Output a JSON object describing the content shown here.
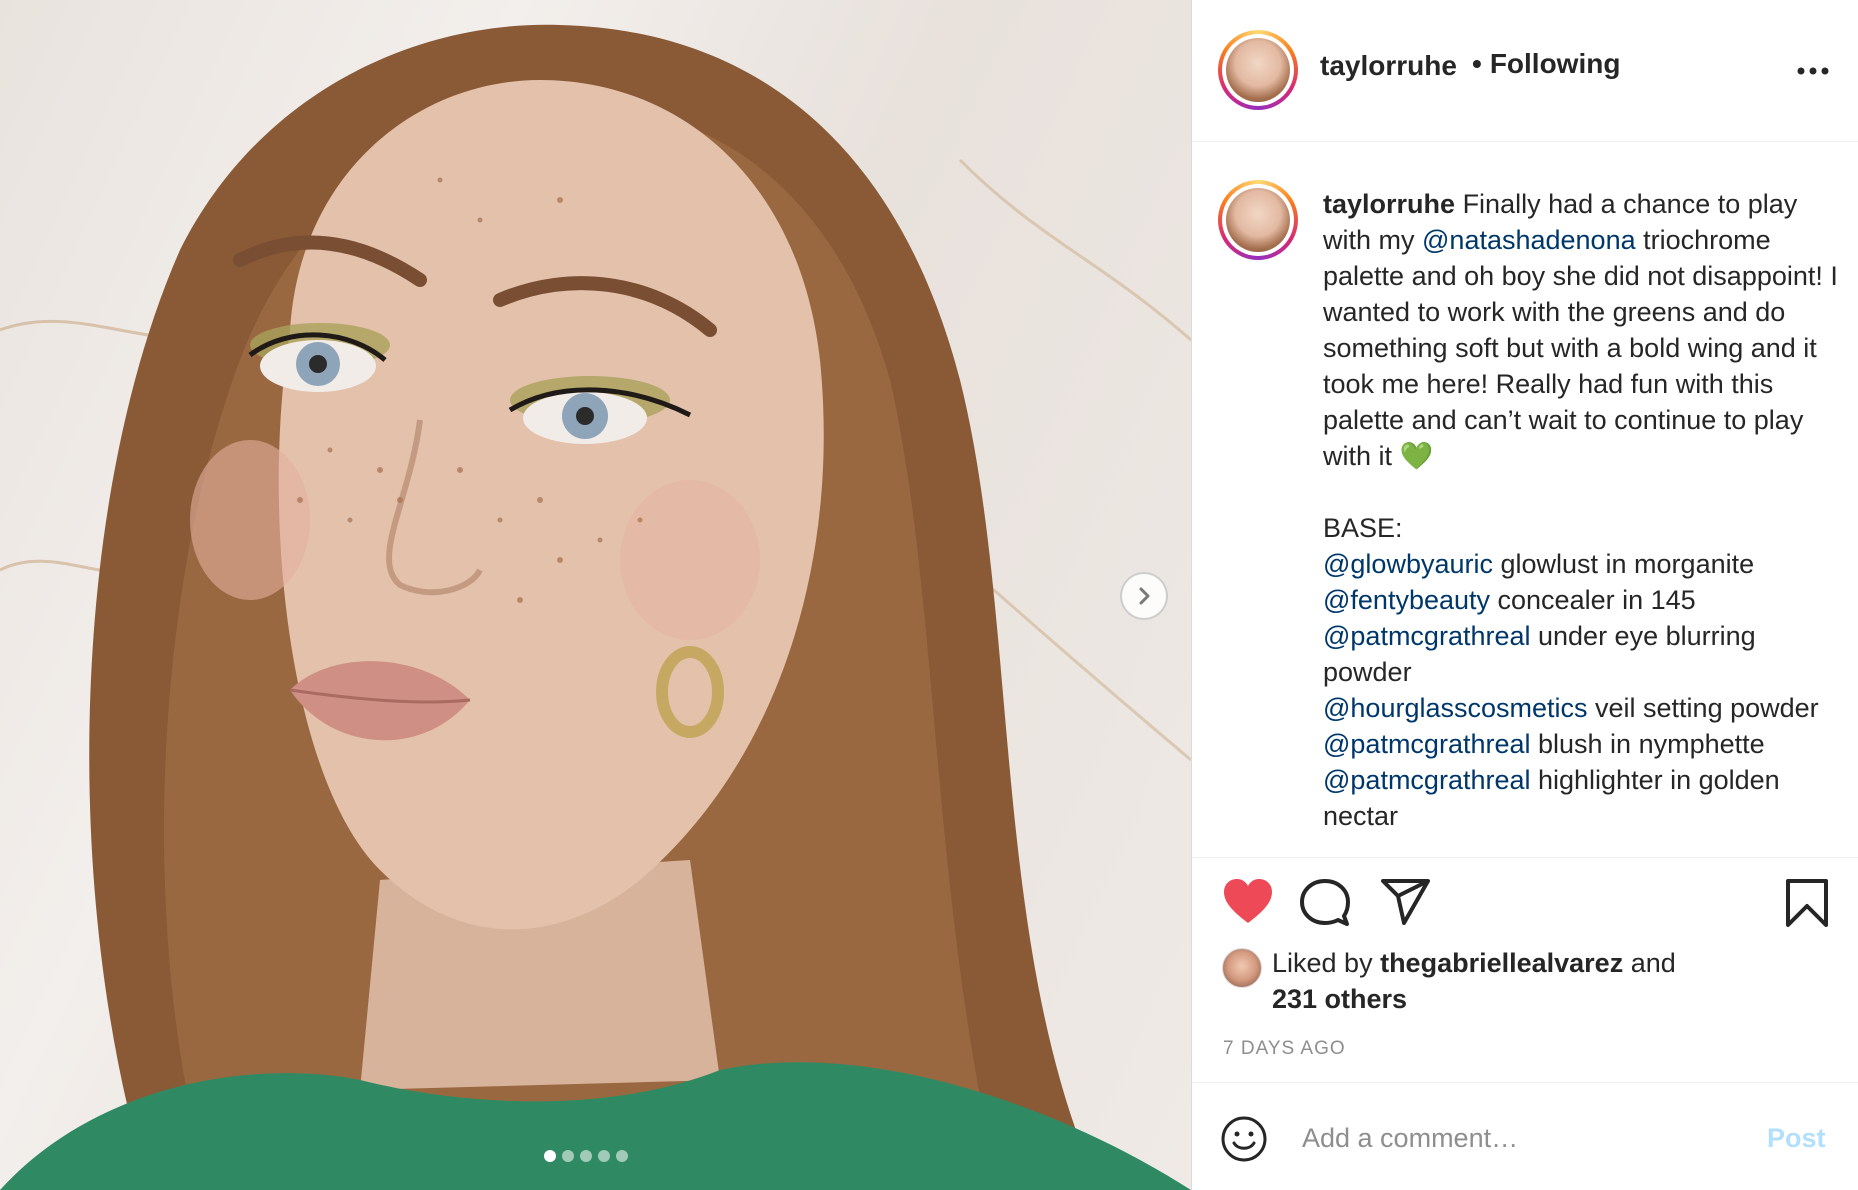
{
  "post": {
    "author": "taylorruhe",
    "follow_status": "Following",
    "follow_bullet": "•",
    "caption_intro": "Finally had a chance to play with my ",
    "caption_mention_1": "@natashadenona",
    "caption_rest": " triochrome palette and oh boy she did not disappoint! I wanted to work with the greens and do something soft but with a bold wing and it took me here! Really had fun with this palette and can’t wait to continue to play with it ",
    "caption_emoji": "💚",
    "base_heading": "BASE:",
    "base_items": [
      {
        "mention": "@glowbyauric",
        "text": " glowlust in morganite"
      },
      {
        "mention": "@fentybeauty",
        "text": " concealer in 145"
      },
      {
        "mention": "@patmcgrathreal",
        "text": " under eye blurring powder"
      },
      {
        "mention": "@hourglasscosmetics",
        "text": " veil setting powder"
      },
      {
        "mention": "@patmcgrathreal",
        "text": " blush in nymphette"
      },
      {
        "mention": "@patmcgrathreal",
        "text": " highlighter in golden nectar"
      }
    ],
    "liked_by_prefix": "Liked by ",
    "liked_by_user": "thegabriellealvarez",
    "liked_by_and": " and",
    "liked_by_others": "231 others",
    "date": "7 DAYS AGO"
  },
  "comment": {
    "placeholder": "Add a comment…",
    "post_label": "Post"
  },
  "carousel": {
    "total": 5,
    "active_index": 0
  },
  "icons": {
    "like": "heart-icon",
    "comment": "comment-icon",
    "share": "share-icon",
    "save": "bookmark-icon",
    "more": "more-icon",
    "emoji": "smile-icon",
    "next": "chevron-right-icon"
  },
  "colors": {
    "like_active": "#ed4956",
    "mention": "#00376b",
    "post_disabled": "#b2dffc",
    "muted": "#8e8e8e"
  }
}
